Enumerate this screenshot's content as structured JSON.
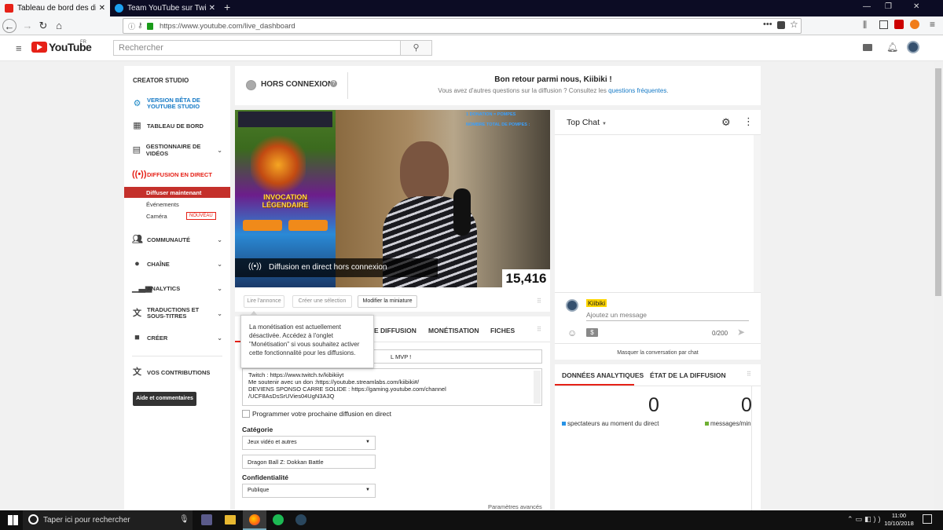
{
  "browser": {
    "tabs": [
      {
        "label": "Tableau de bord des diffusions",
        "icon": "youtube-icon",
        "active": true
      },
      {
        "label": "Team YouTube sur Twitter : \"Bo",
        "icon": "twitter-icon",
        "active": false
      }
    ],
    "url": "https://www.youtube.com/live_dashboard"
  },
  "header": {
    "logo": "YouTube",
    "region": "FR",
    "search_placeholder": "Rechercher"
  },
  "sidebar": {
    "title": "CREATOR STUDIO",
    "items": [
      {
        "label": "VERSION BÊTA DE YOUTUBE STUDIO",
        "icon": "gear-icon"
      },
      {
        "label": "TABLEAU DE BORD",
        "icon": "dashboard-icon"
      },
      {
        "label": "GESTIONNAIRE DE VIDÉOS",
        "icon": "video-manager-icon"
      },
      {
        "label": "DIFFUSION EN DIRECT",
        "icon": "live-icon"
      },
      {
        "label": "COMMUNAUTÉ",
        "icon": "community-icon"
      },
      {
        "label": "CHAÎNE",
        "icon": "channel-icon"
      },
      {
        "label": "ANALYTICS",
        "icon": "analytics-icon"
      },
      {
        "label": "TRADUCTIONS ET SOUS-TITRES",
        "icon": "translate-icon"
      },
      {
        "label": "CRÉER",
        "icon": "create-icon"
      },
      {
        "label": "VOS CONTRIBUTIONS",
        "icon": "contributions-icon"
      }
    ],
    "live_sub": [
      "Diffuser maintenant",
      "Événements",
      "Caméra"
    ],
    "new_badge": "NOUVEAU",
    "help_button": "Aide et commentaires"
  },
  "status": {
    "state": "HORS CONNEXION",
    "welcome": "Bon retour parmi nous, Kiibiki !",
    "question_text": "Vous avez d'autres questions sur la diffusion ? Consultez les",
    "faq_link": "questions fréquentes",
    "period": "."
  },
  "preview": {
    "overlay_text": "Diffusion en direct hors connexion",
    "counter": "15,416",
    "stream_text_1": "1 DONATION = POMPES",
    "stream_text_2": "NOMBRE TOTAL DE POMPES :",
    "game_title": "INVOCATION LÉGENDAIRE"
  },
  "thumb_buttons": [
    "Lire l'annonce",
    "Créer une sélection",
    "Modifier la miniature"
  ],
  "tooltip": "La monétisation est actuellement désactivée. Accédez à l'onglet \"Monétisation\" si vous souhaitez activer cette fonctionnalité pour les diffusions.",
  "info_tabs": [
    "E DIFFUSION",
    "MONÉTISATION",
    "FICHES"
  ],
  "form": {
    "title_value": "L MVP !",
    "description_lines": [
      "Twitch : https://www.twitch.tv/kibikiiyt",
      "Me soutenir avec un don  :https://youtube.streamlabs.com/kiibiki#/",
      "DEVIENS SPONSO CARRE SOLIDE : https://gaming.youtube.com/channel",
      "/UCF8AsDsSrUVies04UgN3A3Q"
    ],
    "schedule_label": "Programmer votre prochaine diffusion en direct",
    "category_label": "Catégorie",
    "category_value": "Jeux vidéo et autres",
    "game_value": "Dragon Ball Z: Dokkan Battle",
    "privacy_label": "Confidentialité",
    "privacy_value": "Publique",
    "advanced": "Paramètres avancés"
  },
  "chat": {
    "title": "Top Chat",
    "username": "Kiibiki",
    "placeholder": "Ajoutez un message",
    "char_count": "0/200",
    "hide": "Masquer la conversation par chat"
  },
  "analytics": {
    "tabs": [
      "DONNÉES ANALYTIQUES",
      "ÉTAT DE LA DIFFUSION"
    ],
    "viewers": "0",
    "viewers_label": "spectateurs au moment du direct",
    "messages": "0",
    "messages_label": "messages/min"
  },
  "taskbar": {
    "search": "Taper ici pour rechercher",
    "time": "11:00",
    "date": "10/10/2018"
  },
  "colors": {
    "youtube_red": "#e62117",
    "link_blue": "#167ac6",
    "accent_blue": "#1d88c6"
  }
}
